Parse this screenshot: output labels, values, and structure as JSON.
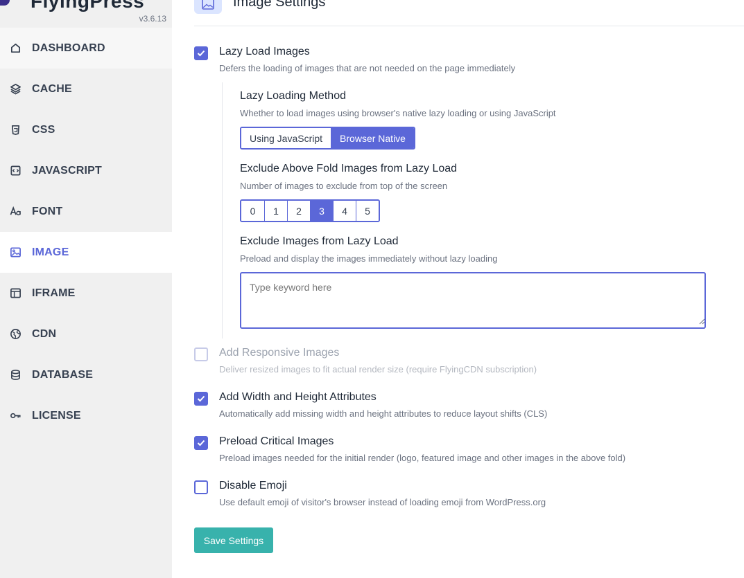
{
  "brand": {
    "name": "FlyingPress",
    "version": "v3.6.13"
  },
  "sidebar": {
    "items": [
      {
        "label": "DASHBOARD",
        "icon": "home-icon"
      },
      {
        "label": "CACHE",
        "icon": "layers-icon"
      },
      {
        "label": "CSS",
        "icon": "css-icon"
      },
      {
        "label": "JAVASCRIPT",
        "icon": "javascript-icon"
      },
      {
        "label": "FONT",
        "icon": "font-icon"
      },
      {
        "label": "IMAGE",
        "icon": "image-icon"
      },
      {
        "label": "IFRAME",
        "icon": "iframe-icon"
      },
      {
        "label": "CDN",
        "icon": "globe-icon"
      },
      {
        "label": "DATABASE",
        "icon": "database-icon"
      },
      {
        "label": "LICENSE",
        "icon": "key-icon"
      }
    ],
    "active": "IMAGE"
  },
  "header": {
    "title": "Image Settings",
    "icon": "image-icon"
  },
  "options": {
    "lazy_load": {
      "title": "Lazy Load Images",
      "desc": "Defers the loading of images that are not needed on the page immediately",
      "checked": true
    },
    "method": {
      "title": "Lazy Loading Method",
      "desc": "Whether to load images using browser's native lazy loading or using JavaScript",
      "choices": [
        "Using JavaScript",
        "Browser Native"
      ],
      "selected": "Browser Native"
    },
    "above_fold": {
      "title": "Exclude Above Fold Images from Lazy Load",
      "desc": "Number of images to exclude from top of the screen",
      "choices": [
        "0",
        "1",
        "2",
        "3",
        "4",
        "5"
      ],
      "selected": "3"
    },
    "exclude": {
      "title": "Exclude Images from Lazy Load",
      "desc": "Preload and display the images immediately without lazy loading",
      "placeholder": "Type keyword here"
    },
    "responsive": {
      "title": "Add Responsive Images",
      "desc": "Deliver resized images to fit actual render size (require FlyingCDN subscription)",
      "checked": false,
      "disabled": true
    },
    "dimensions": {
      "title": "Add Width and Height Attributes",
      "desc": "Automatically add missing width and height attributes to reduce layout shifts (CLS)",
      "checked": true
    },
    "preload": {
      "title": "Preload Critical Images",
      "desc": "Preload images needed for the initial render (logo, featured image and other images in the above fold)",
      "checked": true
    },
    "emoji": {
      "title": "Disable Emoji",
      "desc": "Use default emoji of visitor's browser instead of loading emoji from WordPress.org",
      "checked": false
    }
  },
  "save_label": "Save Settings",
  "colors": {
    "accent": "#5b67d8",
    "save": "#38b2ac",
    "sidebar": "#f0f0f0"
  }
}
